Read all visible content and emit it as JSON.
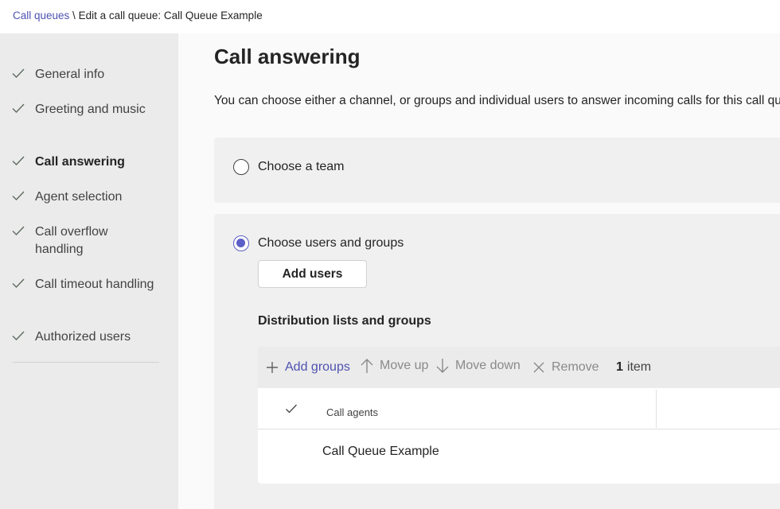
{
  "breadcrumb": {
    "root": "Call queues",
    "separator": " \\ ",
    "current": "Edit a call queue: Call Queue Example"
  },
  "sidebar": {
    "items": [
      {
        "label": "General info",
        "completed": true,
        "active": false
      },
      {
        "label": "Greeting and music",
        "completed": true,
        "active": false
      },
      {
        "label": "Call answering",
        "completed": true,
        "active": true
      },
      {
        "label": "Agent selection",
        "completed": true,
        "active": false
      },
      {
        "label": "Call overflow handling",
        "completed": true,
        "active": false
      },
      {
        "label": "Call timeout handling",
        "completed": true,
        "active": false
      },
      {
        "label": "Authorized users",
        "completed": true,
        "active": false
      }
    ]
  },
  "main": {
    "title": "Call answering",
    "description": "You can choose either a channel, or groups and individual users to answer incoming calls for this call queue.",
    "options": {
      "team": {
        "label": "Choose a team",
        "selected": false
      },
      "users": {
        "label": "Choose users and groups",
        "selected": true
      }
    },
    "add_users_label": "Add users",
    "section_title": "Distribution lists and groups",
    "toolbar": {
      "add_groups": "Add groups",
      "move_up": "Move up",
      "move_down": "Move down",
      "remove": "Remove",
      "count_number": "1",
      "count_label": "item"
    },
    "table": {
      "column": "Call agents",
      "rows": [
        {
          "name": "Call Queue Example"
        }
      ]
    }
  },
  "colors": {
    "accent": "#5b5fc7",
    "link": "#4f52b2",
    "sidebar_bg": "#ebebeb",
    "card_bg": "#f0f0f0"
  }
}
